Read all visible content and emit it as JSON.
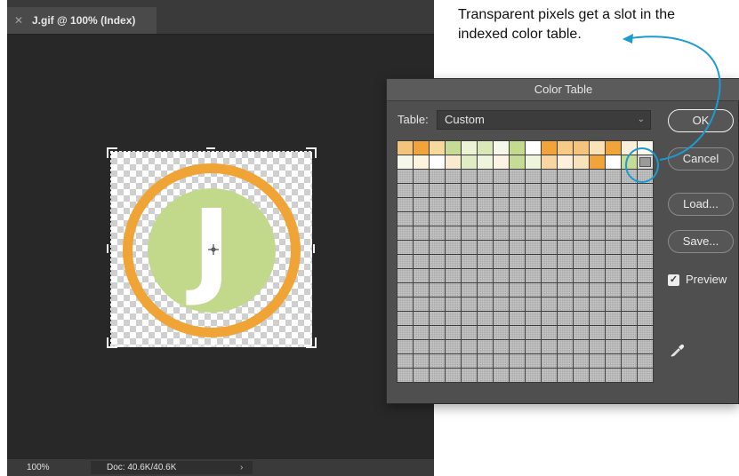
{
  "document": {
    "tab_title": "J.gif @ 100% (Index)",
    "logo_letter": "J",
    "status": {
      "zoom": "100%",
      "doc_size": "Doc: 40.6K/40.6K",
      "chevron": "›"
    },
    "colors": {
      "ring": "#f0a436",
      "disc": "#c2d88a",
      "letter": "#ffffff",
      "canvas_bg": "#282828"
    }
  },
  "dialog": {
    "title": "Color Table",
    "table_label": "Table:",
    "table_value": "Custom",
    "buttons": {
      "ok": "OK",
      "cancel": "Cancel",
      "load": "Load...",
      "save": "Save..."
    },
    "preview_label": "Preview",
    "preview_checked": true,
    "swatches": {
      "row1": [
        "#f4c47c",
        "#f1a43a",
        "#f6d99c",
        "#c6dc96",
        "#edf3d6",
        "#d9e8b6",
        "#f5f8e8",
        "#c4da8c",
        "#fefefe",
        "#f1a43a",
        "#f6cb88",
        "#f4c47c",
        "#f9e2b8",
        "#f1a43a",
        "#fbefd9",
        "#fdf7ec"
      ],
      "row2": [
        "#f5f8e8",
        "#fdf4e0",
        "#fefefe",
        "#faead0",
        "#e0edc4",
        "#eef5dc",
        "#fbf4e4",
        "#c6dc96",
        "#eef5dc",
        "#f7d6a2",
        "#fdf1dc",
        "#f6e3bc",
        "#f1a43a",
        "#fefefe",
        "#c6dc96",
        "transparent"
      ],
      "empty_rows": 15,
      "columns": 16
    }
  },
  "callout": {
    "text": "Transparent pixels get a slot in the indexed color table.",
    "color": "#1b9bd1"
  }
}
